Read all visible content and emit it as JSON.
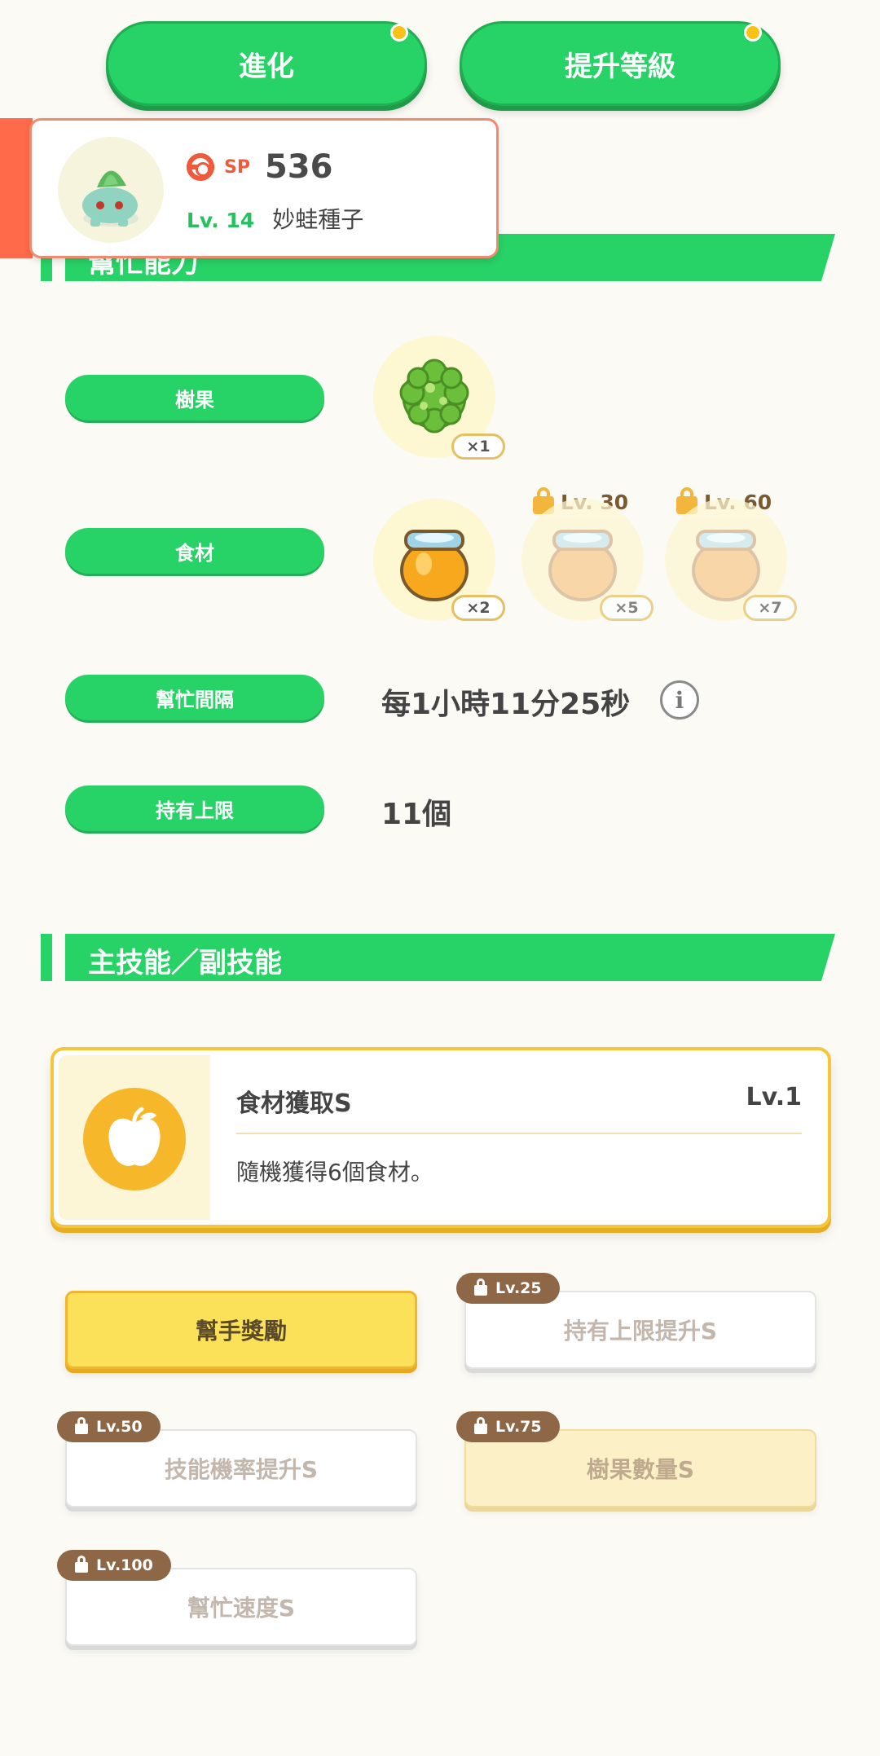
{
  "top_buttons": {
    "evolve": "進化",
    "level_up": "提升等級"
  },
  "pokemon": {
    "sp_label": "SP",
    "sp_value": "536",
    "level": "Lv. 14",
    "name": "妙蛙種子"
  },
  "help_section": {
    "title": "幫忙能力",
    "berry": {
      "label": "樹果",
      "qty": "×1"
    },
    "ingredients": {
      "label": "食材",
      "items": [
        {
          "qty": "×2",
          "locked": false
        },
        {
          "qty": "×5",
          "locked": true,
          "unlock_level": "Lv. 30"
        },
        {
          "qty": "×7",
          "locked": true,
          "unlock_level": "Lv. 60"
        }
      ]
    },
    "interval": {
      "label": "幫忙間隔",
      "value": "每1小時11分25秒"
    },
    "capacity": {
      "label": "持有上限",
      "value": "11個"
    }
  },
  "skills_section": {
    "title": "主技能／副技能",
    "main_skill": {
      "name": "食材獲取S",
      "level": "Lv.1",
      "description": "隨機獲得6個食材。",
      "icon": "apple-icon"
    },
    "sub_skills": [
      {
        "name": "幫手獎勵",
        "unlock": "",
        "state": "active"
      },
      {
        "name": "持有上限提升S",
        "unlock": "Lv.25",
        "state": "locked"
      },
      {
        "name": "技能機率提升S",
        "unlock": "Lv.50",
        "state": "locked"
      },
      {
        "name": "樹果數量S",
        "unlock": "Lv.75",
        "state": "locked-gold"
      },
      {
        "name": "幫忙速度S",
        "unlock": "Lv.100",
        "state": "locked"
      }
    ]
  },
  "colors": {
    "accent_green": "#27d266",
    "gold": "#f5c63a",
    "sp_red": "#f05a3c"
  }
}
